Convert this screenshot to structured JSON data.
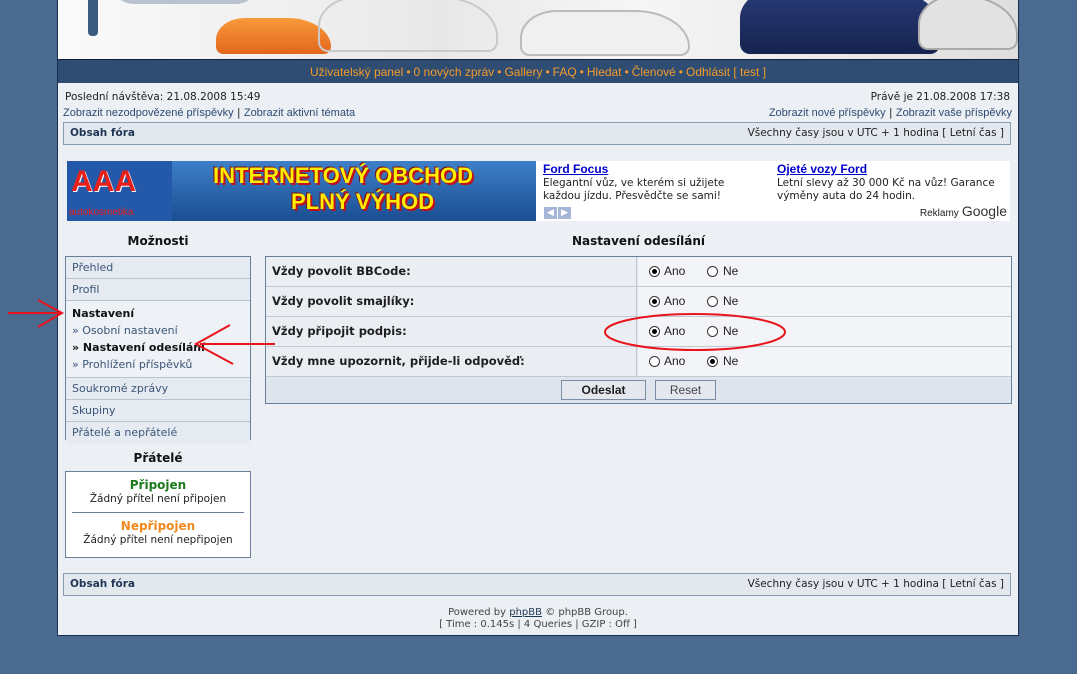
{
  "nav": {
    "items": [
      "Uživatelský panel",
      "0 nových zpráv",
      "Gallery",
      "FAQ",
      "Hledat",
      "Členové",
      "Odhlásit [ test ]"
    ],
    "separator": "•"
  },
  "info": {
    "last_visit": "Poslední návštěva: 21.08.2008 15:49",
    "now": "Právě je 21.08.2008 17:38",
    "link_unanswered": "Zobrazit nezodpovězené příspěvky",
    "link_active": "Zobrazit aktivní témata",
    "link_new": "Zobrazit nové příspěvky",
    "link_yours": "Zobrazit vaše příspěvky",
    "pipe": "|"
  },
  "bar": {
    "index": "Obsah fóra",
    "timezone": "Všechny časy jsou v UTC + 1 hodina [ Letní čas ]"
  },
  "ad": {
    "logo_text": "AAA",
    "logo_sub": "autokosmetika",
    "banner_line1": "INTERNETOVÝ OBCHOD",
    "banner_line2": "PLNÝ VÝHOD",
    "ad1_title": "Ford Focus",
    "ad1_text": "Elegantní vůz, ve kterém si užijete každou jízdu. Přesvědčte se sami!",
    "ad2_title": "Ojeté vozy Ford",
    "ad2_text": "Letní slevy až 30 000 Kč na vůz! Garance výměny auta do 24 hodin.",
    "ads_by": "Reklamy",
    "google": "Google"
  },
  "sidebar": {
    "title": "Možnosti",
    "items": [
      "Přehled",
      "Profil"
    ],
    "group_title": "Nastavení",
    "group_items": [
      "» Osobní nastavení",
      "» Nastavení odesílání",
      "» Prohlížení příspěvků"
    ],
    "items_after": [
      "Soukromé zprávy",
      "Skupiny",
      "Přátelé a nepřátelé"
    ]
  },
  "friends": {
    "title": "Přátelé",
    "online": "Připojen",
    "online_none": "Žádný přítel není připojen",
    "offline": "Nepřipojen",
    "offline_none": "Žádný přítel není nepřipojen"
  },
  "main": {
    "title": "Nastavení odesílání",
    "yes": "Ano",
    "no": "Ne",
    "rows": [
      {
        "label": "Vždy povolit BBCode:",
        "value": "Ano"
      },
      {
        "label": "Vždy povolit smajlíky:",
        "value": "Ano"
      },
      {
        "label": "Vždy připojit podpis:",
        "value": "Ano"
      },
      {
        "label": "Vždy mne upozornit, přijde-li odpověď:",
        "value": "Ne"
      }
    ],
    "submit": "Odeslat",
    "reset": "Reset"
  },
  "footer": {
    "powered_prefix": "Powered by",
    "phpbb": "phpBB",
    "powered_suffix": "© phpBB Group.",
    "stats": "[ Time : 0.145s | 4 Queries | GZIP : Off ]"
  },
  "colors": {
    "page_bg": "#4a6a90",
    "nav_bg": "#2f4d72",
    "nav_link": "#f39a2b",
    "annotation": "#e8141c"
  }
}
